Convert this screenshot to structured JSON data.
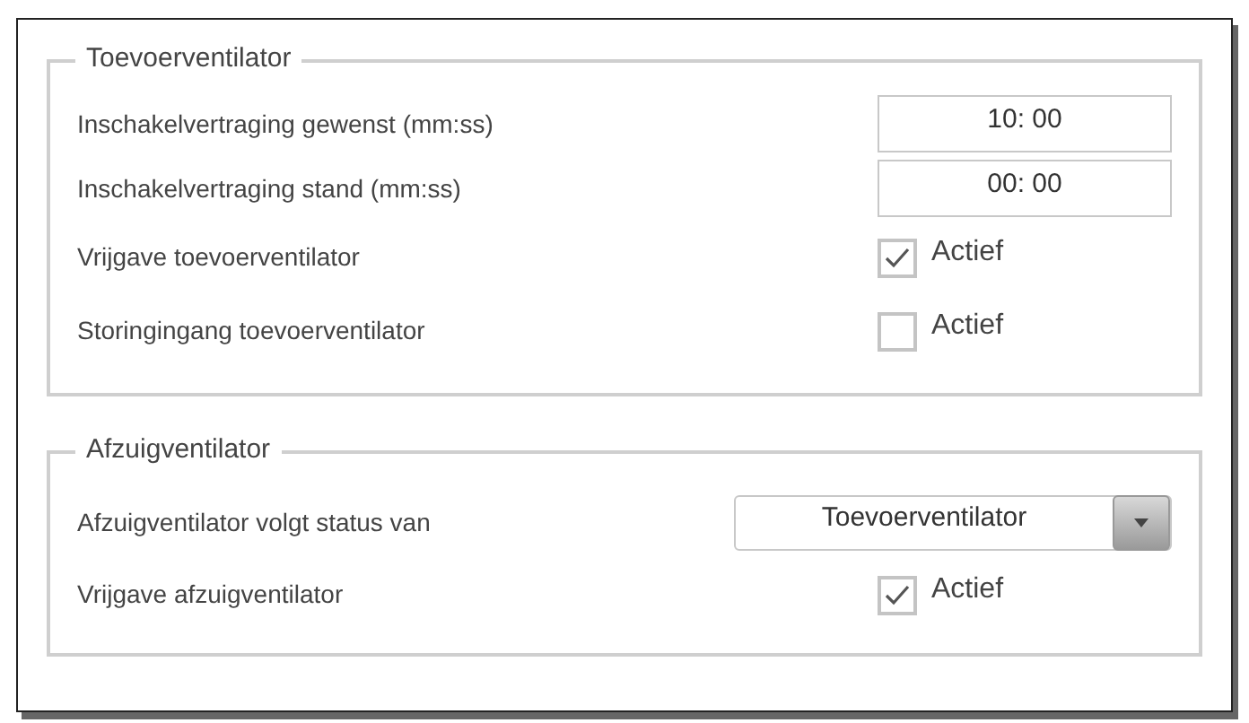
{
  "groups": [
    {
      "title": "Toevoerventilator",
      "rows": [
        {
          "kind": "field",
          "label": "Inschakelvertraging gewenst (mm:ss)",
          "value": "10: 00"
        },
        {
          "kind": "field",
          "label": "Inschakelvertraging stand (mm:ss)",
          "value": "00: 00"
        },
        {
          "kind": "checkbox",
          "label": "Vrijgave toevoerventilator",
          "checked": true,
          "text": "Actief"
        },
        {
          "kind": "checkbox",
          "label": "Storingingang toevoerventilator",
          "checked": false,
          "text": "Actief"
        }
      ]
    },
    {
      "title": "Afzuigventilator",
      "rows": [
        {
          "kind": "dropdown",
          "label": "Afzuigventilator volgt status van",
          "value": "Toevoerventilator"
        },
        {
          "kind": "checkbox",
          "label": "Vrijgave afzuigventilator",
          "checked": true,
          "text": "Actief"
        }
      ]
    }
  ]
}
